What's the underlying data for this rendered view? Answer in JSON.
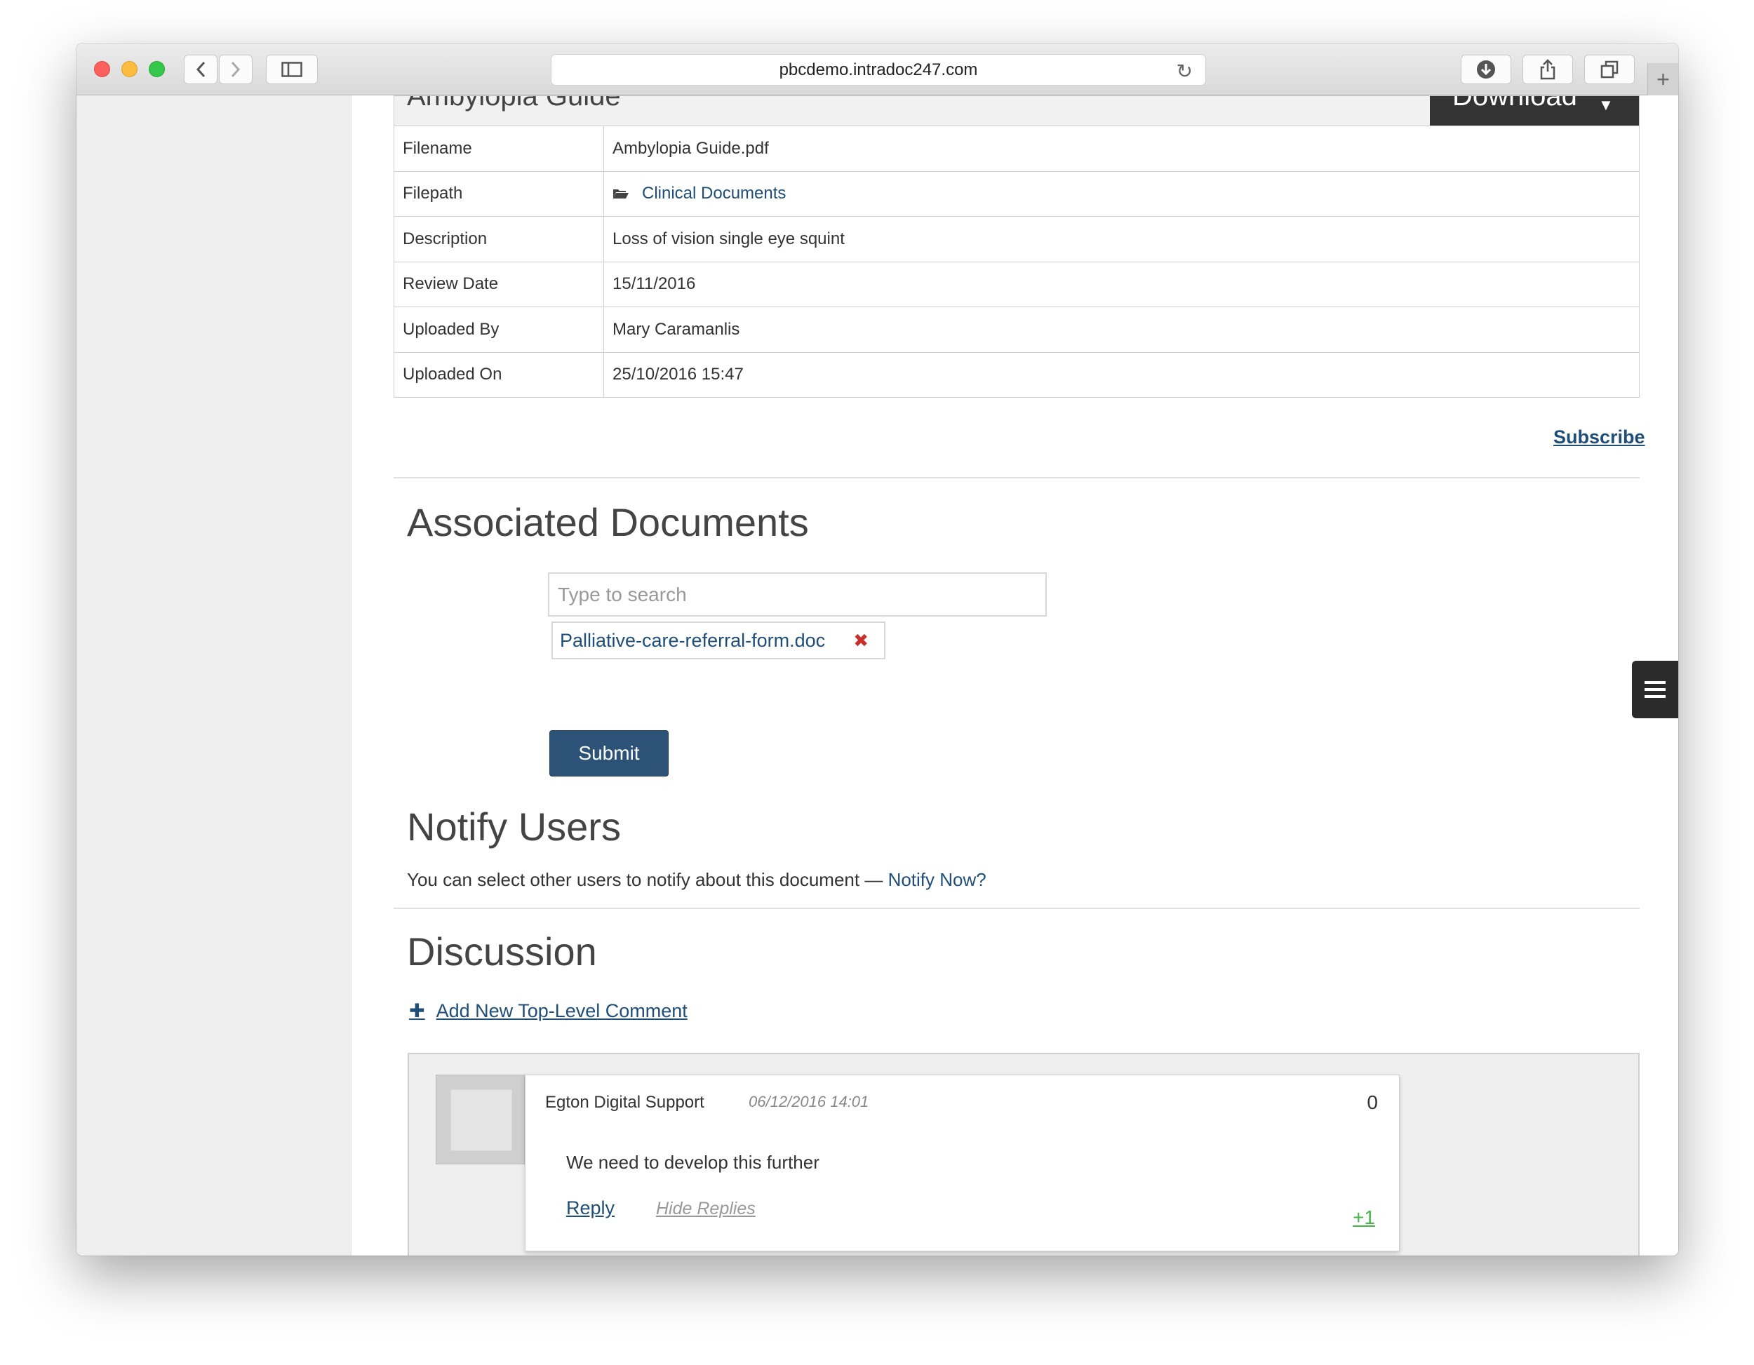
{
  "browser": {
    "url": "pbcdemo.intradoc247.com",
    "new_tab": "+"
  },
  "document": {
    "title": "Ambylopia Guide",
    "download_label": "Download",
    "fields": [
      {
        "key": "Filename",
        "value": "Ambylopia Guide.pdf"
      },
      {
        "key": "Filepath",
        "value": "Clinical Documents"
      },
      {
        "key": "Description",
        "value": "Loss of vision single eye squint"
      },
      {
        "key": "Review Date",
        "value": "15/11/2016"
      },
      {
        "key": "Uploaded By",
        "value": "Mary Caramanlis"
      },
      {
        "key": "Uploaded On",
        "value": "25/10/2016 15:47"
      }
    ],
    "subscribe_label": "Subscribe"
  },
  "associated": {
    "heading": "Associated Documents",
    "search_placeholder": "Type to search",
    "selected_doc": "Palliative-care-referral-form.doc",
    "submit_label": "Submit"
  },
  "notify": {
    "heading": "Notify Users",
    "text": "You can select other users to notify about this document —",
    "link": "Notify Now?"
  },
  "discussion": {
    "heading": "Discussion",
    "add_comment": "Add New Top-Level Comment",
    "comments": [
      {
        "author": "Egton Digital Support",
        "date": "06/12/2016 14:01",
        "score": "0",
        "body": "We need to develop this further",
        "reply_label": "Reply",
        "hide_label": "Hide Replies",
        "plus_label": "+1"
      }
    ]
  },
  "colors": {
    "link": "#1f4e79",
    "submit": "#2d5277",
    "delete": "#c9302c",
    "upvote": "#46b446"
  }
}
